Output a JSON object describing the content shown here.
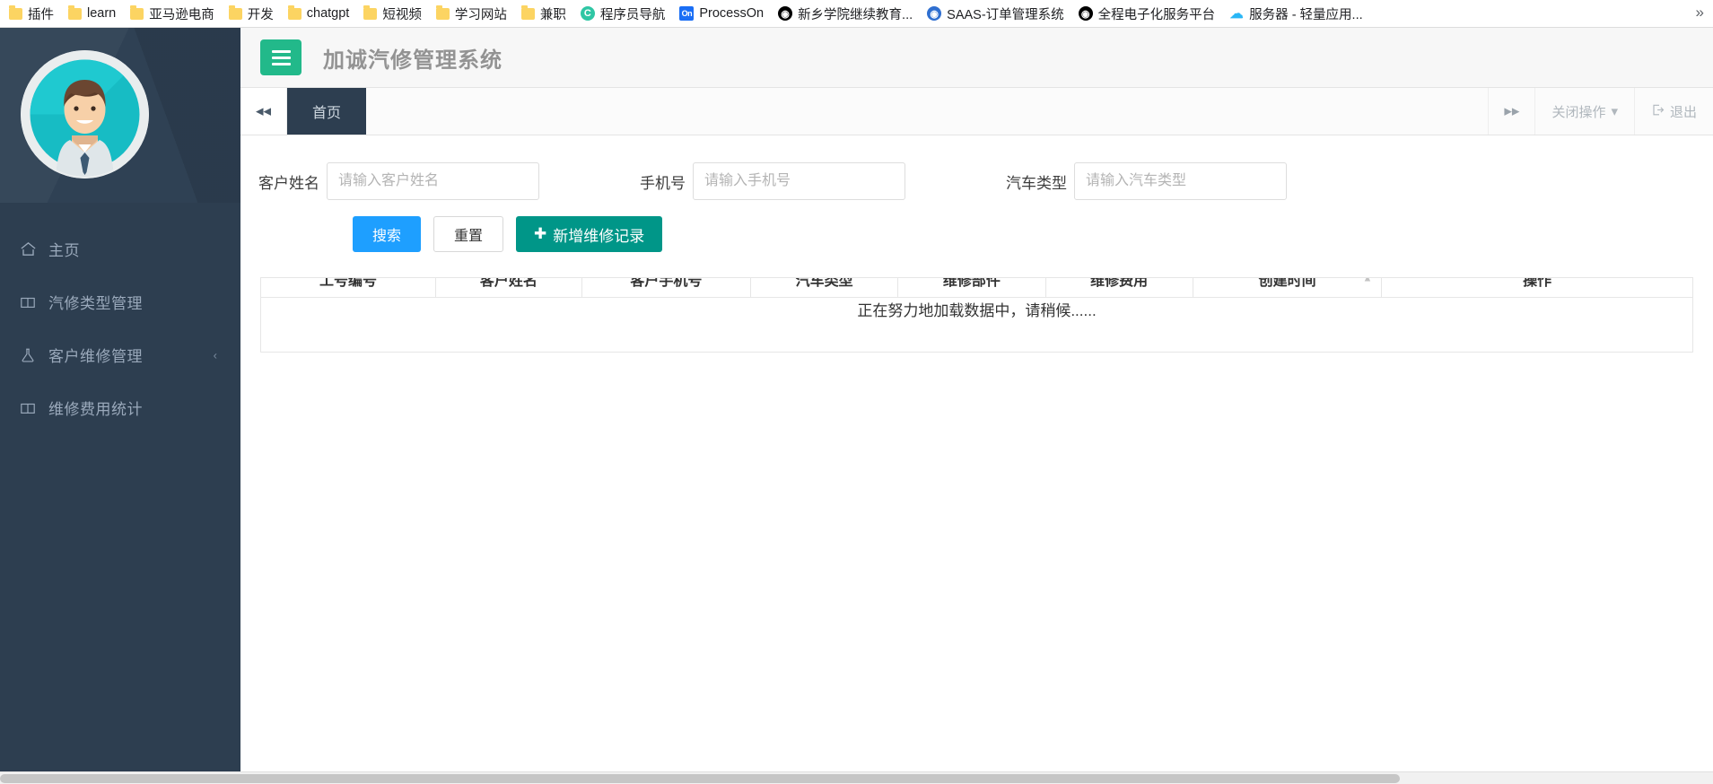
{
  "browser": {
    "bookmarks": [
      {
        "label": "插件",
        "icon": "folder-icon"
      },
      {
        "label": "learn",
        "icon": "folder-icon"
      },
      {
        "label": "亚马逊电商",
        "icon": "folder-icon"
      },
      {
        "label": "开发",
        "icon": "folder-icon"
      },
      {
        "label": "chatgpt",
        "icon": "folder-icon"
      },
      {
        "label": "短视频",
        "icon": "folder-icon"
      },
      {
        "label": "学习网站",
        "icon": "folder-icon"
      },
      {
        "label": "兼职",
        "icon": "folder-icon"
      },
      {
        "label": "程序员导航",
        "icon": "c-badge-icon",
        "glyph": "C"
      },
      {
        "label": "ProcessOn",
        "icon": "on-badge-icon",
        "glyph": "On"
      },
      {
        "label": "新乡学院继续教育...",
        "icon": "globe-icon",
        "glyph": "◉"
      },
      {
        "label": "SAAS-订单管理系统",
        "icon": "blue-globe-icon",
        "glyph": "◉"
      },
      {
        "label": "全程电子化服务平台",
        "icon": "globe-icon",
        "glyph": "◉"
      },
      {
        "label": "服务器 - 轻量应用...",
        "icon": "cloud-icon",
        "glyph": "☁"
      }
    ],
    "overflow_label": "»"
  },
  "header": {
    "menu_toggle_icon": "hamburger-icon",
    "title": "加诚汽修管理系统"
  },
  "tabbar": {
    "prev_icon": "chevron-double-left-icon",
    "next_icon": "chevron-double-right-icon",
    "tabs": [
      {
        "label": "首页",
        "active": true
      }
    ],
    "close_ops_label": "关闭操作",
    "close_ops_caret": "▾",
    "logout_label": "退出",
    "logout_icon": "logout-icon"
  },
  "sidebar": {
    "avatar_alt": "user-avatar",
    "items": [
      {
        "label": "主页",
        "icon": "home-icon",
        "has_caret": false
      },
      {
        "label": "汽修类型管理",
        "icon": "columns-icon",
        "has_caret": false
      },
      {
        "label": "客户维修管理",
        "icon": "flask-icon",
        "has_caret": true,
        "caret": "‹"
      },
      {
        "label": "维修费用统计",
        "icon": "columns-icon",
        "has_caret": false
      }
    ]
  },
  "search": {
    "fields": [
      {
        "label": "客户姓名",
        "placeholder": "请输入客户姓名",
        "value": ""
      },
      {
        "label": "手机号",
        "placeholder": "请输入手机号",
        "value": ""
      },
      {
        "label": "汽车类型",
        "placeholder": "请输入汽车类型",
        "value": ""
      }
    ],
    "buttons": {
      "search": "搜索",
      "reset": "重置",
      "add": "新增维修记录",
      "add_icon": "plus-icon"
    }
  },
  "table": {
    "columns": [
      {
        "label": "工号编号",
        "sortable": false
      },
      {
        "label": "客户姓名",
        "sortable": false
      },
      {
        "label": "客户手机号",
        "sortable": false
      },
      {
        "label": "汽车类型",
        "sortable": false
      },
      {
        "label": "维修部件",
        "sortable": false
      },
      {
        "label": "维修费用",
        "sortable": false
      },
      {
        "label": "创建时间",
        "sortable": true,
        "sort_icon": "▲"
      },
      {
        "label": "操作",
        "sortable": false
      }
    ],
    "rows": [],
    "loading_text": "正在努力地加载数据中，请稍候......"
  },
  "colors": {
    "sidebar_bg": "#2d3e50",
    "accent_green": "#22b98a",
    "primary_blue": "#1e9fff",
    "success_teal": "#009688",
    "tab_active_bg": "#2d3e50"
  }
}
